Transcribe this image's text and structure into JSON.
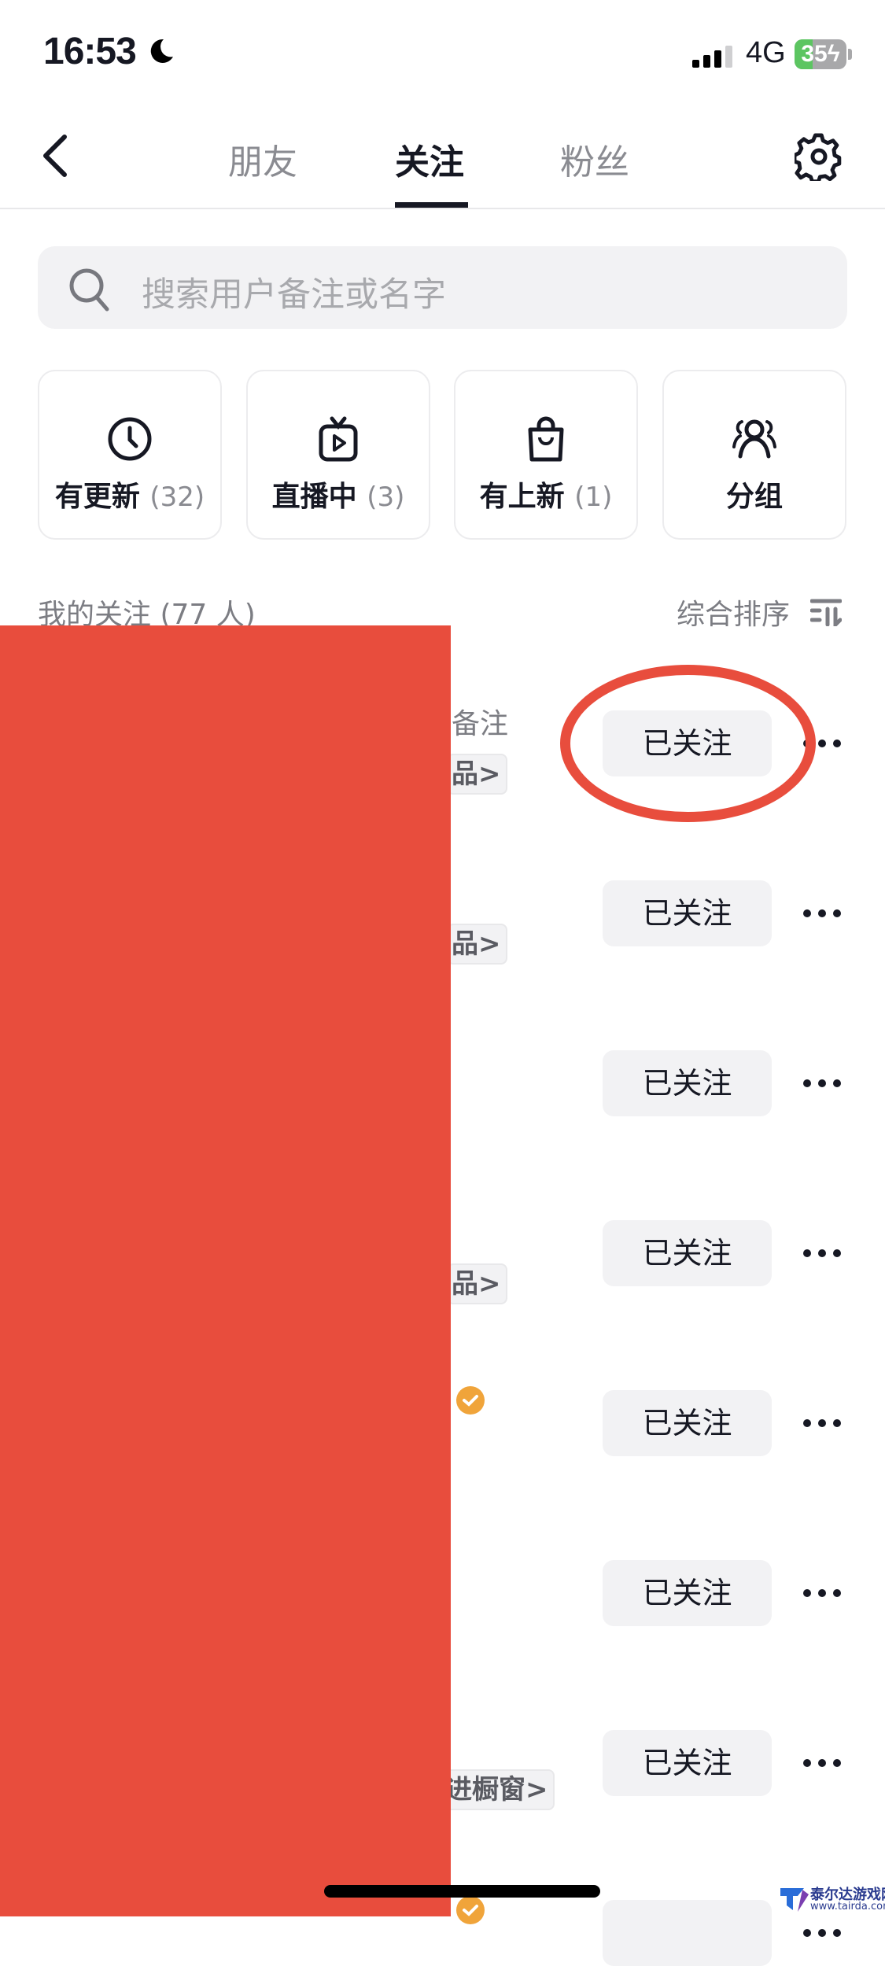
{
  "status_bar": {
    "time": "16:53",
    "network": "4G",
    "battery_percent": 35,
    "battery_label": "35",
    "charging": true,
    "signal_bars": 3,
    "signal_max": 4
  },
  "nav": {
    "tabs": [
      {
        "label": "朋友",
        "active": false
      },
      {
        "label": "关注",
        "active": true
      },
      {
        "label": "粉丝",
        "active": false
      }
    ]
  },
  "search": {
    "placeholder": "搜索用户备注或名字"
  },
  "cards": [
    {
      "icon": "clock-icon",
      "label": "有更新",
      "count": "(32)"
    },
    {
      "icon": "live-tv-icon",
      "label": "直播中",
      "count": "(3)"
    },
    {
      "icon": "shopping-bag-icon",
      "label": "有上新",
      "count": "(1)"
    },
    {
      "icon": "group-icon",
      "label": "分组",
      "count": ""
    }
  ],
  "section": {
    "title": "我的关注 (77 人)",
    "sort_label": "综合排序"
  },
  "rows": [
    {
      "remark": "备注",
      "tag": "品>",
      "verified": false,
      "button": "已关注"
    },
    {
      "remark": "",
      "tag": "品>",
      "verified": false,
      "button": "已关注"
    },
    {
      "remark": "",
      "tag": "",
      "verified": false,
      "button": "已关注"
    },
    {
      "remark": "",
      "tag": "品>",
      "verified": false,
      "button": "已关注"
    },
    {
      "remark": "",
      "tag": "",
      "verified": true,
      "button": "已关注"
    },
    {
      "remark": "",
      "tag": "",
      "verified": false,
      "button": "已关注"
    },
    {
      "remark": "",
      "tag": "进橱窗>",
      "verified": false,
      "button": "已关注"
    },
    {
      "remark": "",
      "tag": "",
      "verified": true,
      "button": ""
    }
  ],
  "watermark": {
    "title": "泰尔达游戏网",
    "url": "www.tairda.com"
  },
  "colors": {
    "accent_red": "#e84d3d",
    "verified": "#f0a43a",
    "battery_green": "#5cc561"
  }
}
